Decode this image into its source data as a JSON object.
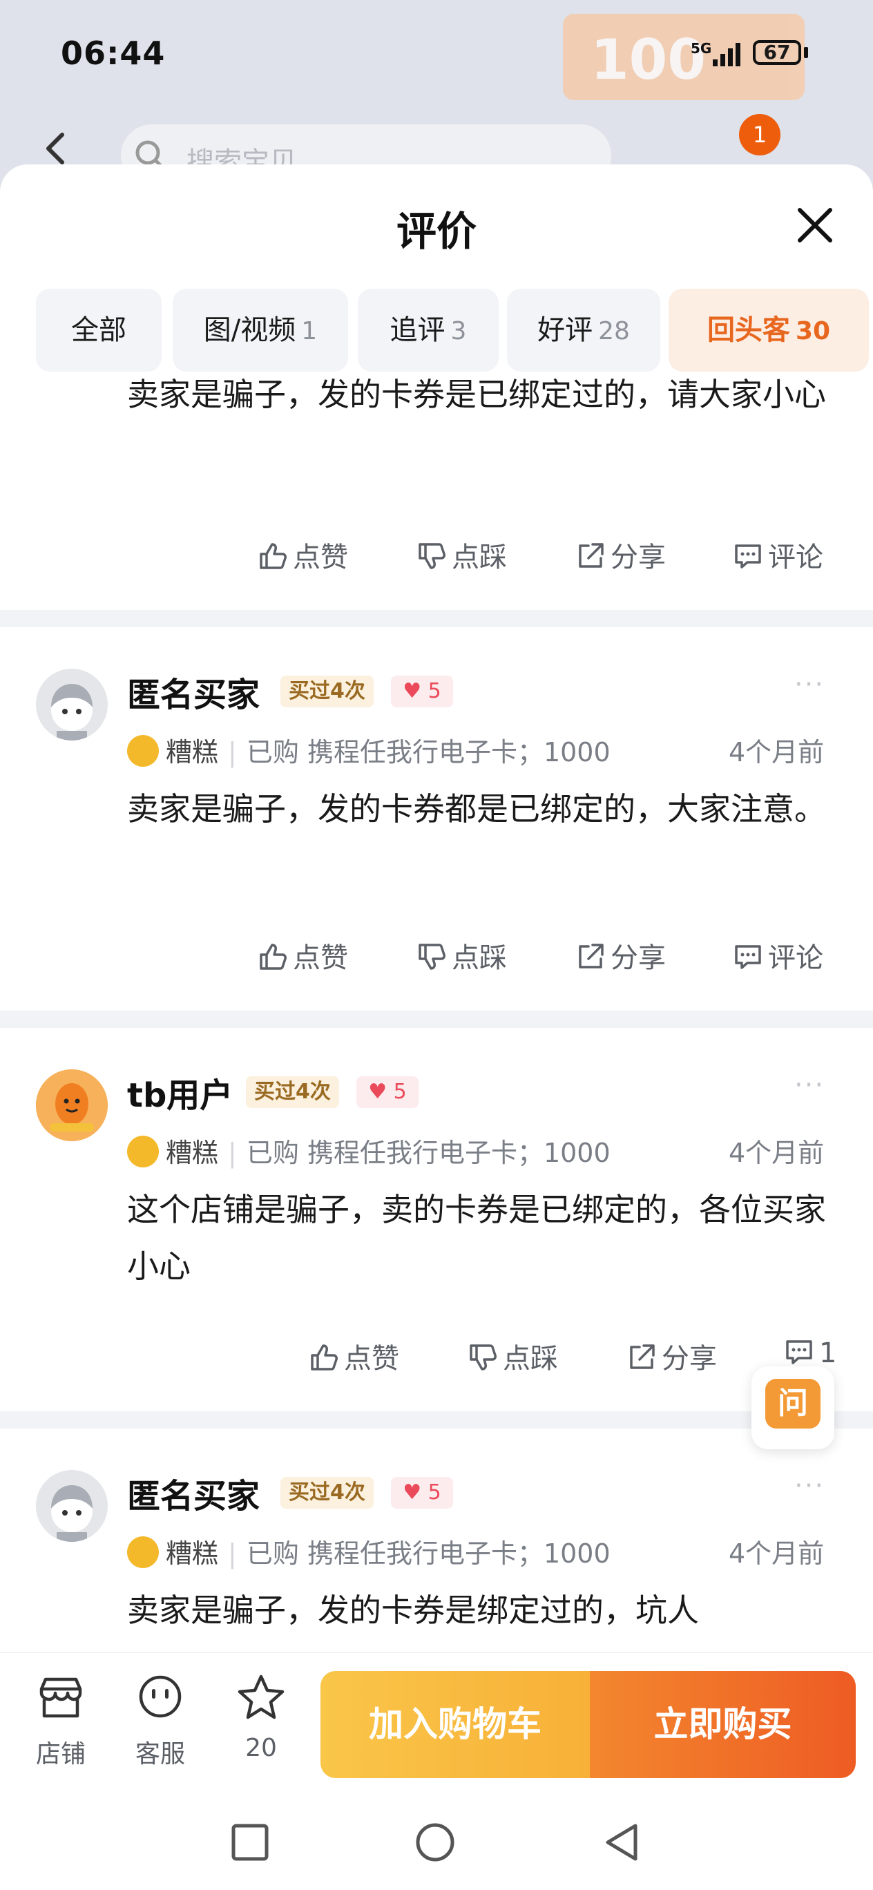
{
  "status_bar": {
    "time": "06:44",
    "network": "5G",
    "battery": "67"
  },
  "background": {
    "promo_number": "100",
    "search_placeholder": "搜索宝贝",
    "cart_badge": "1"
  },
  "sheet": {
    "title": "评价",
    "tabs": [
      {
        "label": "全部",
        "count": ""
      },
      {
        "label": "图/视频",
        "count": "1"
      },
      {
        "label": "追评",
        "count": "3"
      },
      {
        "label": "好评",
        "count": "28"
      },
      {
        "label": "回头客",
        "count": "30",
        "active": true
      }
    ]
  },
  "actions": {
    "like": "点赞",
    "dislike": "点踩",
    "share": "分享",
    "comment": "评论"
  },
  "reviews": [
    {
      "text": "卖家是骗子，发的卡券是已绑定过的，请大家小心"
    },
    {
      "user": "匿名买家",
      "bought": "买过4次",
      "fan_level": "5",
      "mood": "糟糕",
      "purchased_prefix": "已购",
      "item": "携程任我行电子卡；1000",
      "time": "4个月前",
      "text": "卖家是骗子，发的卡券都是已绑定的，大家注意。"
    },
    {
      "user": "tb用户",
      "bought": "买过4次",
      "fan_level": "5",
      "mood": "糟糕",
      "purchased_prefix": "已购",
      "item": "携程任我行电子卡；1000",
      "time": "4个月前",
      "text": "这个店铺是骗子，卖的卡券是已绑定的，各位买家小心",
      "comment_count": "1"
    },
    {
      "user": "匿名买家",
      "bought": "买过4次",
      "fan_level": "5",
      "mood": "糟糕",
      "purchased_prefix": "已购",
      "item": "携程任我行电子卡；1000",
      "time": "4个月前",
      "text": "卖家是骗子，发的卡券是绑定过的，坑人"
    }
  ],
  "ask_button": "问",
  "bottom_bar": {
    "shop": "店铺",
    "service": "客服",
    "favorites": "20",
    "add_to_cart": "加入购物车",
    "buy_now": "立即购买"
  },
  "colors": {
    "accent": "#E8671F",
    "cart_gradient": "#F9C649",
    "buy_gradient": "#EE5C24"
  }
}
